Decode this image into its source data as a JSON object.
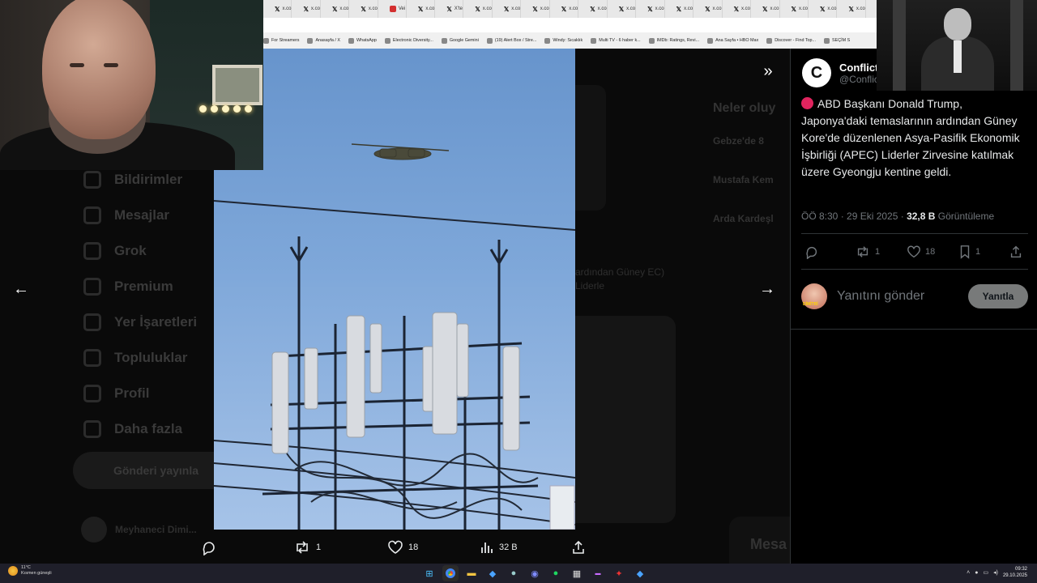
{
  "browser": {
    "tabs": [
      "x.co",
      "x.co",
      "x.co",
      "x.co",
      "Vei",
      "x.co",
      "X'te",
      "x.co",
      "x.co",
      "x.co",
      "x.co",
      "x.co",
      "x.co",
      "x.co",
      "x.co",
      "x.co",
      "x.co",
      "x.co",
      "x.co",
      "x.co",
      "x.co"
    ],
    "bookmarks": [
      "For Streamers",
      "Anasayfa / X",
      "WhatsApp",
      "Electronic Diversity...",
      "Google Gemini",
      "(19) Alert Box / Stre...",
      "Windy: Sıcaklık",
      "Multi TV - 6 haber k...",
      "IMDb: Ratings, Revi...",
      "Ana Sayfa • HBO Max",
      "Discover - Find Top...",
      "SEÇİM S"
    ]
  },
  "background": {
    "nav": [
      "Bildirimler",
      "Mesajlar",
      "Grok",
      "Premium",
      "Yer İşaretleri",
      "Topluluklar",
      "Profil",
      "Daha fazla"
    ],
    "post_button": "Gönderi yayınla",
    "user_name": "Meyhaneci Dimi...",
    "right_heading": "Neler oluy",
    "right_items": [
      "Gebze'de 8",
      "Mustafa Kem",
      "Arda Kardeşl"
    ],
    "feed_text": "ardından Güney EC) Liderle",
    "messages": "Mesa"
  },
  "viewer": {
    "actions": {
      "reply": "",
      "retweet": "1",
      "like": "18",
      "views": "32 B",
      "share": ""
    }
  },
  "tweet": {
    "author_name": "Conflict",
    "author_handle": "@Conflic",
    "text": "ABD Başkanı Donald Trump, Japonya'daki temaslarının ardından Güney Kore'de düzenlenen Asya-Pasifik Ekonomik İşbirliği (APEC) Liderler Zirvesine katılmak üzere Gyeongju kentine geldi.",
    "time": "ÖÖ 8:30 · 29 Eki 2025 · ",
    "views_count": "32,8 B",
    "views_label": " Görüntüleme",
    "stats": {
      "replies": "",
      "retweets": "1",
      "likes": "18",
      "bookmarks": "1"
    },
    "reply_placeholder": "Yanıtını gönder",
    "reply_button": "Yanıtla",
    "reply_avatar_text": "DİMİTRİ"
  },
  "taskbar": {
    "weather_temp": "11°C",
    "weather_desc": "Kısmen güneşli",
    "time": "09:32",
    "date": "29.10.2025"
  },
  "colors": {
    "accent": "#1d9bf0",
    "bg": "#000000",
    "muted": "#71767b",
    "text": "#e7e9ea"
  }
}
